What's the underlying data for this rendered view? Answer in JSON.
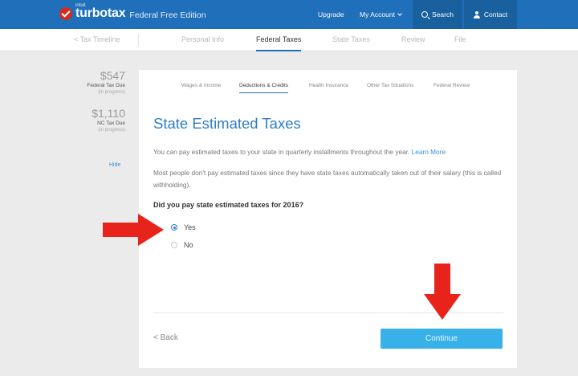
{
  "brand": {
    "intuit": "intuit",
    "name": "turbotax",
    "edition": "Federal Free Edition"
  },
  "topnav": {
    "upgrade": "Upgrade",
    "account": "My Account",
    "search": "Search",
    "contact": "Contact"
  },
  "subnav": {
    "timeline": "< Tax Timeline",
    "tabs": [
      "Personal Info",
      "Federal Taxes",
      "State Taxes",
      "Review",
      "File"
    ],
    "active_tab": "Federal Taxes"
  },
  "summary": {
    "federal": {
      "amount": "$547",
      "label": "Federal Tax Due",
      "status": "(in progress)"
    },
    "state": {
      "amount": "$1,110",
      "label": "NC Tax Due",
      "status": "(in progress)"
    },
    "hide": "Hide"
  },
  "steps": [
    "Wages & Income",
    "Deductions & Credits",
    "Health Insurance",
    "Other Tax Situations",
    "Federal Review"
  ],
  "page": {
    "title": "State Estimated Taxes",
    "para1": "You can pay estimated taxes to your state in quarterly installments throughout the year.",
    "learn_more": "Learn More",
    "para2": "Most people don't pay estimated taxes since they have state taxes automatically taken out of their salary (this is called withholding).",
    "question": "Did you pay state estimated taxes for 2016?",
    "options": [
      "Yes",
      "No"
    ],
    "selected": "Yes",
    "back": "< Back",
    "continue": "Continue"
  },
  "colors": {
    "header": "#1f6fbb",
    "accent": "#2d7ec3",
    "continue": "#38b1e8",
    "annotation": "#e8231c"
  }
}
